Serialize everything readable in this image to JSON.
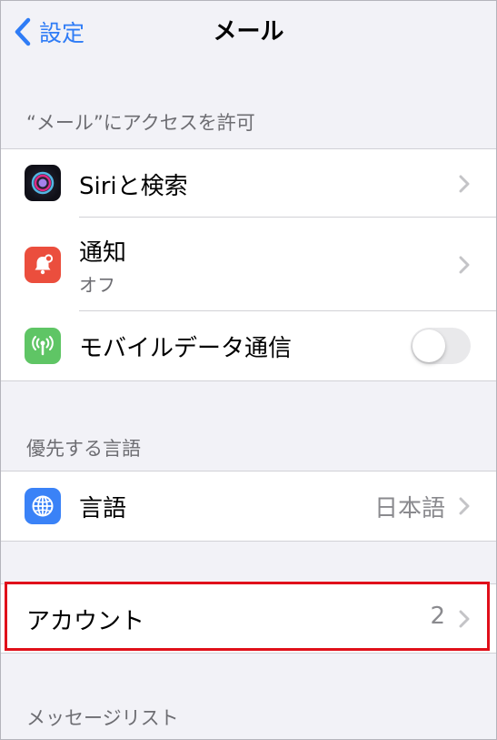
{
  "navbar": {
    "back_label": "設定",
    "title": "メール"
  },
  "sections": {
    "access_header": "“メール”にアクセスを許可",
    "language_header": "優先する言語",
    "message_list_header": "メッセージリスト"
  },
  "access": {
    "siri": {
      "label": "Siriと検索"
    },
    "notifications": {
      "label": "通知",
      "sub": "オフ"
    },
    "cellular": {
      "label": "モバイルデータ通信",
      "enabled": false
    }
  },
  "language": {
    "label": "言語",
    "value": "日本語"
  },
  "accounts": {
    "label": "アカウント",
    "value": "2"
  },
  "colors": {
    "accent": "#2f7cf6",
    "notifications_icon": "#eb4e3d",
    "cellular_icon": "#5fc565",
    "language_icon": "#3a82f7",
    "highlight": "#e0101a"
  }
}
